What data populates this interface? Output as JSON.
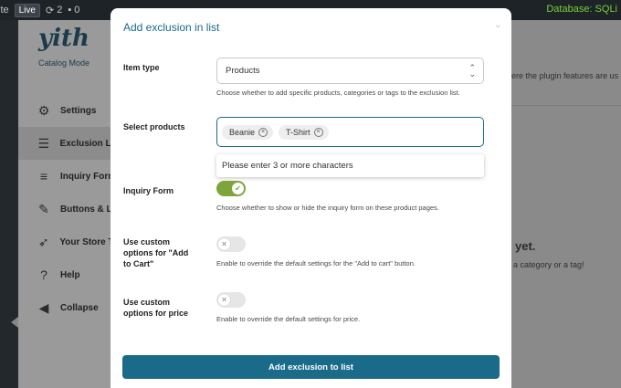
{
  "admin_bar": {
    "site": "ite",
    "live_badge": "Live",
    "updates_count": "2",
    "comments_count": "0",
    "database": "Database: SQLi"
  },
  "plugin": {
    "brand": "yith",
    "brand_subtitle": "Catalog Mode",
    "nav": [
      {
        "label": "Settings",
        "icon": "gear-icon"
      },
      {
        "label": "Exclusion Lis",
        "icon": "list-icon"
      },
      {
        "label": "Inquiry Form",
        "icon": "form-icon"
      },
      {
        "label": "Buttons & La",
        "icon": "brush-icon"
      },
      {
        "label": "Your Store To",
        "icon": "rocket-icon"
      },
      {
        "label": "Help",
        "icon": "help-icon"
      },
      {
        "label": "Collapse",
        "icon": "collapse-icon"
      }
    ]
  },
  "background_main": {
    "text1": "ere the plugin features are us",
    "text2": "yet.",
    "text3": "a category or a tag!"
  },
  "modal": {
    "title": "Add exclusion in list",
    "item_type": {
      "label": "Item type",
      "value": "Products",
      "help": "Choose whether to add specific products, categories or tags to the exclusion list."
    },
    "select_products": {
      "label": "Select products",
      "tags": [
        "Beanie",
        "T-Shirt"
      ],
      "suggestion": "Please enter 3 or more characters"
    },
    "inquiry_form": {
      "label": "Inquiry Form",
      "help": "Choose whether to show or hide the inquiry form on these product pages.",
      "enabled": true
    },
    "custom_add_to_cart": {
      "label_line1": "Use custom",
      "label_line2": "options for \"Add",
      "label_line3": "to Cart\"",
      "help": "Enable to override the default settings for the \"Add to cart\" button.",
      "enabled": false
    },
    "custom_price": {
      "label_line1": "Use custom",
      "label_line2": "options for price",
      "help": "Enable to override the default settings for price.",
      "enabled": false
    },
    "submit_label": "Add exclusion to list"
  },
  "colors": {
    "accent": "#1a6a8a",
    "toggle_on": "#7ea53b"
  }
}
